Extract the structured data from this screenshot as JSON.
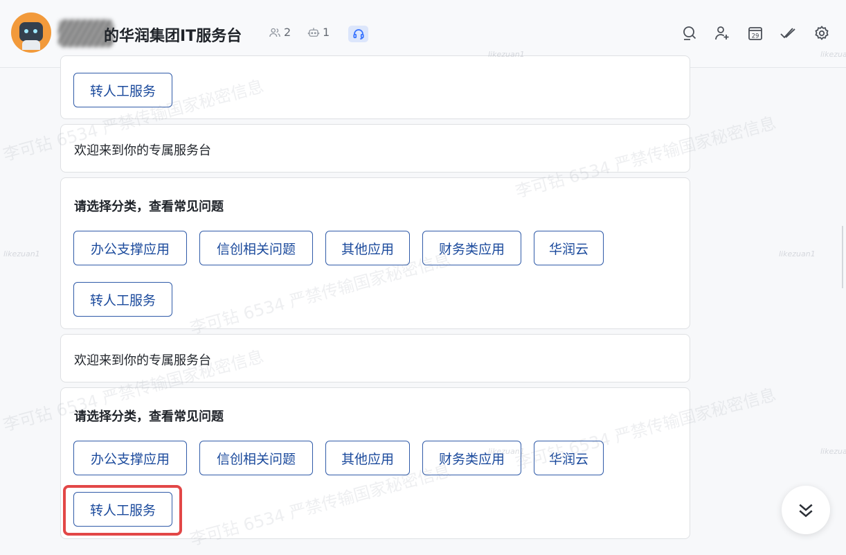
{
  "header": {
    "title": "的华润集团IT服务台",
    "members_count": "2",
    "bots_count": "1",
    "tool_icons": [
      "search-icon",
      "add-member-icon",
      "calendar-icon",
      "task-check-icon",
      "settings-icon"
    ],
    "calendar_day": "29"
  },
  "messages": [
    {
      "type": "partial-card",
      "buttons": [
        "转人工服务"
      ]
    },
    {
      "type": "text",
      "text": "欢迎来到你的专属服务台"
    },
    {
      "type": "menu",
      "heading": "请选择分类，查看常见问题",
      "buttons": [
        "办公支撑应用",
        "信创相关问题",
        "其他应用",
        "财务类应用",
        "华润云",
        "转人工服务"
      ]
    },
    {
      "type": "text",
      "text": "欢迎来到你的专属服务台"
    },
    {
      "type": "menu",
      "heading": "请选择分类，查看常见问题",
      "buttons": [
        "办公支撑应用",
        "信创相关问题",
        "其他应用",
        "财务类应用",
        "华润云",
        "转人工服务"
      ]
    }
  ],
  "watermark": {
    "line": "李可钻 6534 严禁传输国家秘密信息",
    "username": "likezuan1"
  },
  "colors": {
    "accent": "#1b4a9c",
    "highlight": "#e24747"
  }
}
